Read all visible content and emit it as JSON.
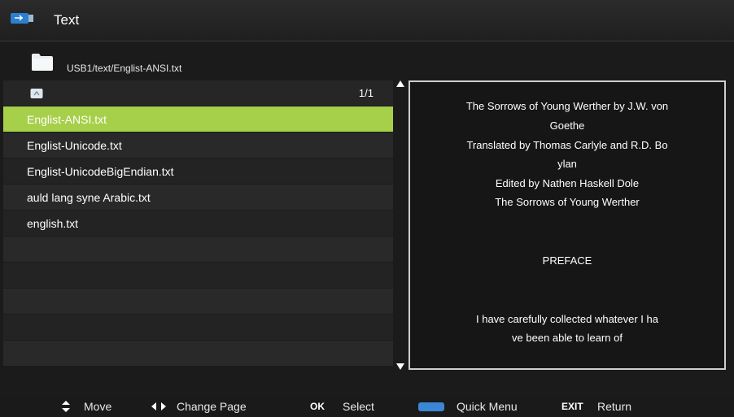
{
  "header": {
    "title": "Text"
  },
  "path": {
    "current": "USB1/text/Englist-ANSI.txt"
  },
  "list": {
    "page_indicator": "1/1",
    "items": [
      {
        "label": "Englist-ANSI.txt"
      },
      {
        "label": "Englist-Unicode.txt"
      },
      {
        "label": "Englist-UnicodeBigEndian.txt"
      },
      {
        "label": "auld lang syne Arabic.txt"
      },
      {
        "label": "english.txt"
      }
    ],
    "selected_index": 0
  },
  "preview": {
    "lines": [
      "The Sorrows of Young Werther by J.W. von",
      "Goethe",
      "Translated by Thomas Carlyle and R.D. Bo",
      "ylan",
      "Edited by Nathen Haskell Dole",
      "The Sorrows of Young Werther",
      "PREFACE",
      "I have carefully collected whatever I ha",
      "ve been able to learn of"
    ]
  },
  "footer": {
    "move_label": "Move",
    "change_page_label": "Change Page",
    "ok_key": "OK",
    "select_label": "Select",
    "quick_menu_label": "Quick Menu",
    "exit_key": "EXIT",
    "return_label": "Return"
  },
  "colors": {
    "selection": "#a6cf4a",
    "quick_menu_key": "#3b86d6",
    "usb_icon": "#2d7fd0"
  }
}
